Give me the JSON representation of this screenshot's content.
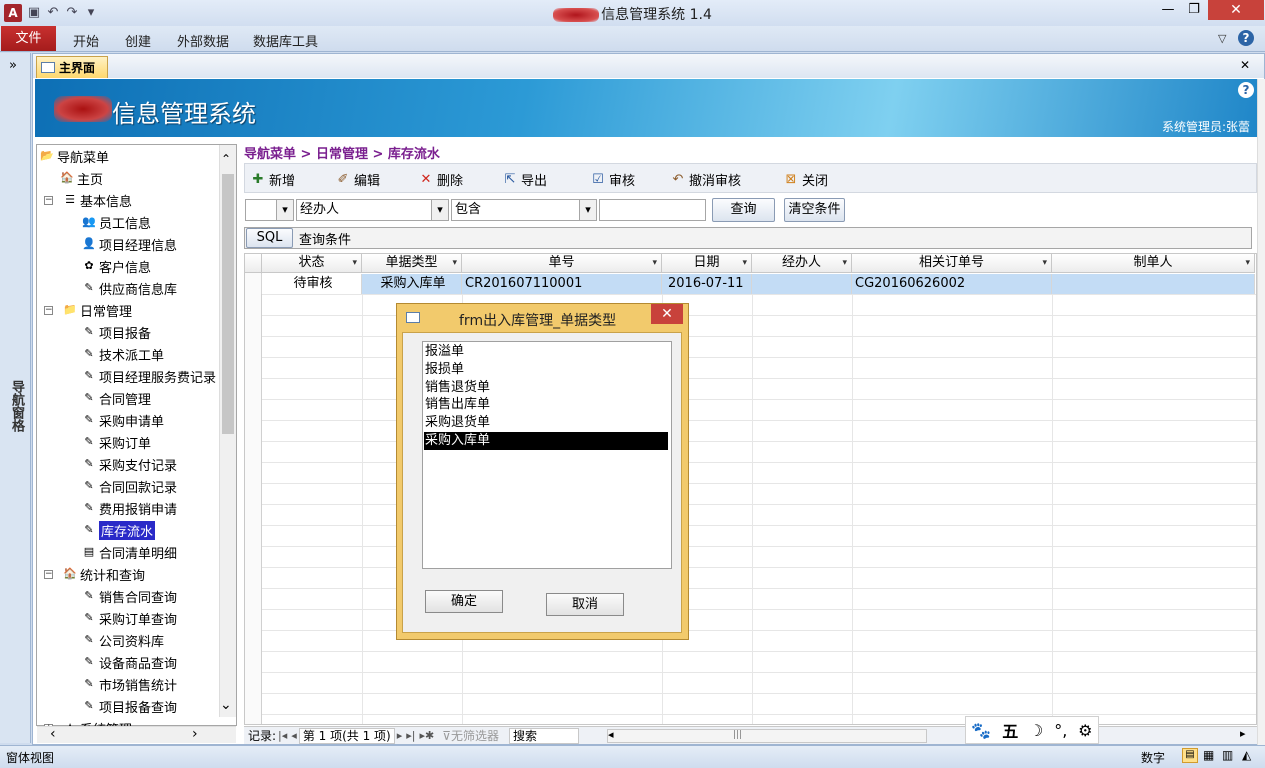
{
  "window": {
    "title": "信息管理系统 1.4",
    "app_icon": "A",
    "min": "—",
    "max": "❐",
    "close": "✕"
  },
  "ribbon": {
    "file": "文件",
    "tabs": [
      "开始",
      "创建",
      "外部数据",
      "数据库工具"
    ],
    "help": "?"
  },
  "nav_pane": {
    "label": "导航窗格",
    "toggle": "»"
  },
  "form_tab": {
    "title": "主界面",
    "close": "✕"
  },
  "banner": {
    "title": "信息管理系统",
    "user": "系统管理员:张蕾",
    "help": "?"
  },
  "tree": {
    "items": [
      {
        "label": "导航菜单",
        "icon": "📂",
        "level": 0
      },
      {
        "label": "主页",
        "icon": "🏠",
        "level": 1
      },
      {
        "label": "基本信息",
        "icon": "☰",
        "level": 1,
        "expand": "−"
      },
      {
        "label": "员工信息",
        "icon": "👥",
        "level": 2
      },
      {
        "label": "项目经理信息",
        "icon": "👤",
        "level": 2
      },
      {
        "label": "客户信息",
        "icon": "✿",
        "level": 2
      },
      {
        "label": "供应商信息库",
        "icon": "✎",
        "level": 2
      },
      {
        "label": "日常管理",
        "icon": "📁",
        "level": 1,
        "expand": "−"
      },
      {
        "label": "项目报备",
        "icon": "✎",
        "level": 2
      },
      {
        "label": "技术派工单",
        "icon": "✎",
        "level": 2
      },
      {
        "label": "项目经理服务费记录",
        "icon": "✎",
        "level": 2
      },
      {
        "label": "合同管理",
        "icon": "✎",
        "level": 2
      },
      {
        "label": "采购申请单",
        "icon": "✎",
        "level": 2
      },
      {
        "label": "采购订单",
        "icon": "✎",
        "level": 2
      },
      {
        "label": "采购支付记录",
        "icon": "✎",
        "level": 2
      },
      {
        "label": "合同回款记录",
        "icon": "✎",
        "level": 2
      },
      {
        "label": "费用报销申请",
        "icon": "✎",
        "level": 2
      },
      {
        "label": "库存流水",
        "icon": "✎",
        "level": 2,
        "selected": true
      },
      {
        "label": "合同清单明细",
        "icon": "▤",
        "level": 2
      },
      {
        "label": "统计和查询",
        "icon": "🏠",
        "level": 1,
        "expand": "−"
      },
      {
        "label": "销售合同查询",
        "icon": "✎",
        "level": 2
      },
      {
        "label": "采购订单查询",
        "icon": "✎",
        "level": 2
      },
      {
        "label": "公司资料库",
        "icon": "✎",
        "level": 2
      },
      {
        "label": "设备商品查询",
        "icon": "✎",
        "level": 2
      },
      {
        "label": "市场销售统计",
        "icon": "✎",
        "level": 2
      },
      {
        "label": "项目报备查询",
        "icon": "✎",
        "level": 2
      },
      {
        "label": "系统管理",
        "icon": "★",
        "level": 1,
        "expand": "+"
      }
    ]
  },
  "breadcrumb": "导航菜单 > 日常管理 > 库存流水",
  "toolbar": [
    {
      "label": "新增",
      "icon": "✚"
    },
    {
      "label": "编辑",
      "icon": "✐"
    },
    {
      "label": "删除",
      "icon": "✕"
    },
    {
      "label": "导出",
      "icon": "⇱"
    },
    {
      "label": "审核",
      "icon": "☑"
    },
    {
      "label": "撤消审核",
      "icon": "↶"
    },
    {
      "label": "关闭",
      "icon": "⊠"
    }
  ],
  "filter": {
    "field0": "",
    "field": "经办人",
    "op": "包含",
    "value": "",
    "query_btn": "查询",
    "clear_btn": "清空条件",
    "sql_btn": "SQL",
    "sql_text": "查询条件"
  },
  "grid": {
    "columns": [
      "状态",
      "单据类型",
      "单号",
      "日期",
      "经办人",
      "相关订单号",
      "制单人"
    ],
    "rows": [
      [
        "待审核",
        "采购入库单",
        "CR201607110001",
        "2016-07-11",
        "",
        "CG20160626002",
        ""
      ]
    ]
  },
  "record_nav": {
    "label": "记录:",
    "position": "第 1 项(共 1 项)",
    "nofilter": "无筛选器",
    "search": "搜索"
  },
  "ime": [
    "🐾",
    "五",
    "☽",
    "°,",
    "⚙"
  ],
  "status": {
    "left": "窗体视图",
    "right": "数字"
  },
  "dialog": {
    "title": "frm出入库管理_单据类型",
    "close": "✕",
    "options": [
      "报溢单",
      "报损单",
      "销售退货单",
      "销售出库单",
      "采购退货单",
      "采购入库单"
    ],
    "selected": "采购入库单",
    "ok": "确定",
    "cancel": "取消"
  }
}
